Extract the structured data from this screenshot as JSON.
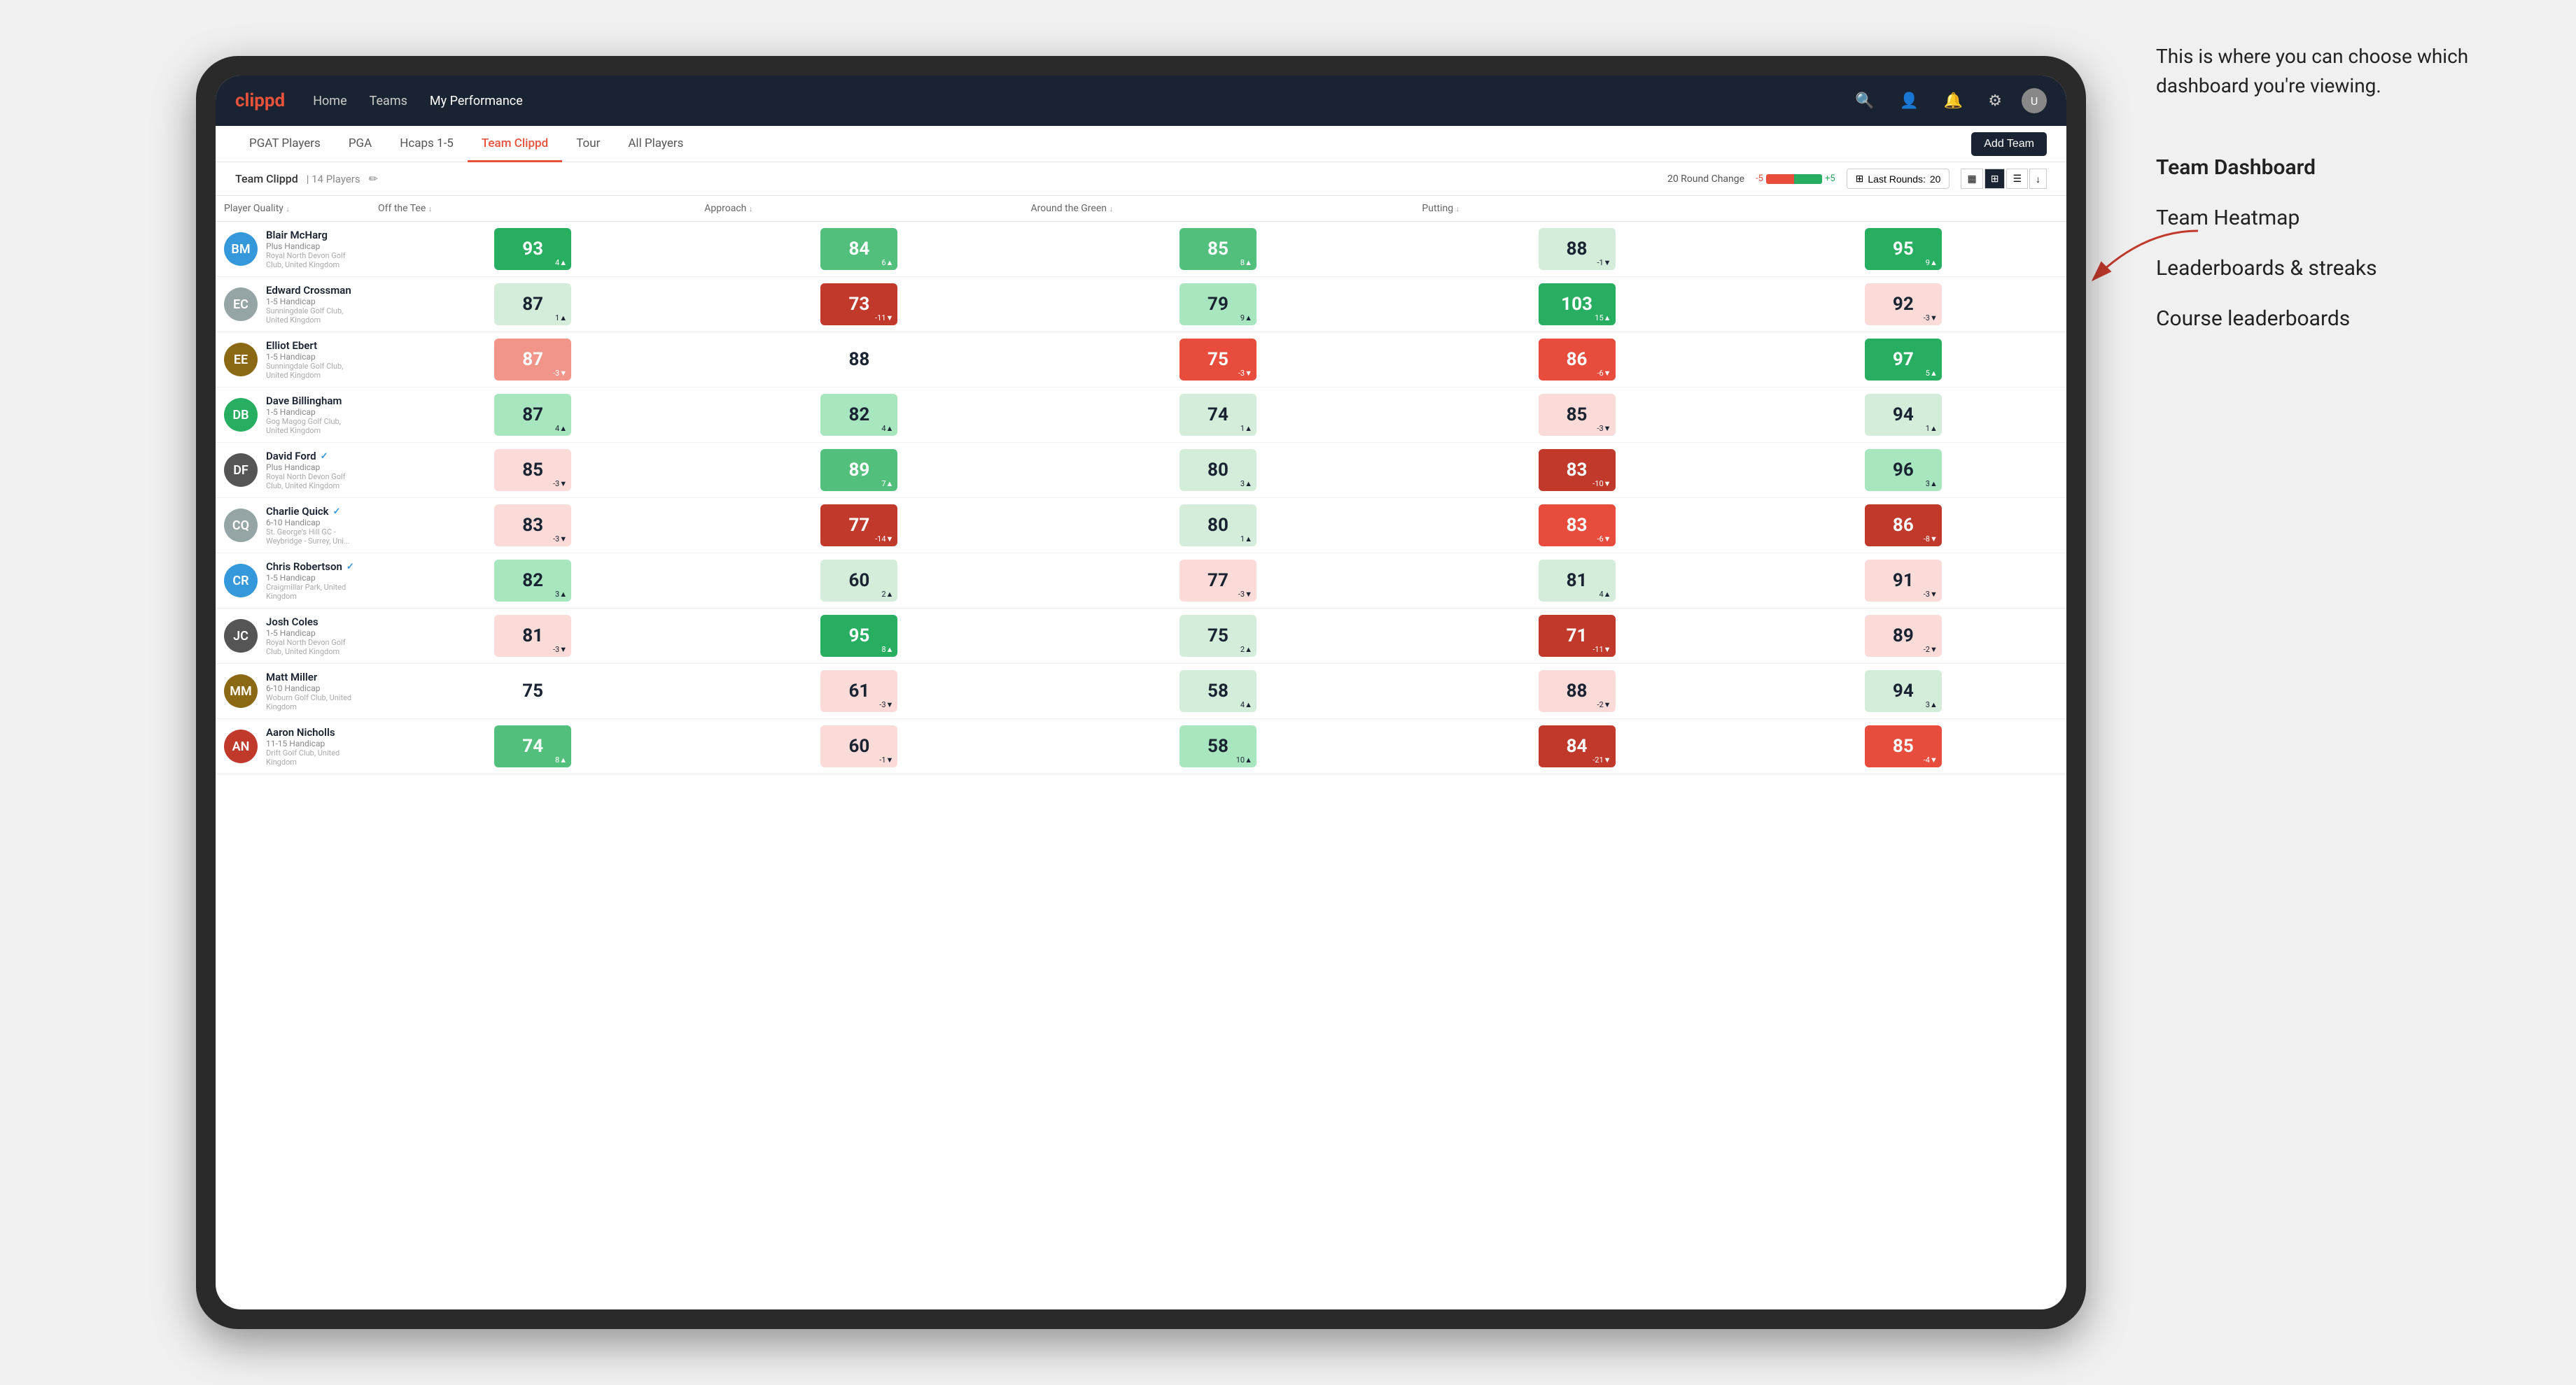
{
  "annotation": {
    "intro": "This is where you can choose which dashboard you're viewing.",
    "items": [
      {
        "label": "Team Dashboard",
        "active": true
      },
      {
        "label": "Team Heatmap",
        "active": false
      },
      {
        "label": "Leaderboards & streaks",
        "active": false
      },
      {
        "label": "Course leaderboards",
        "active": false
      }
    ]
  },
  "nav": {
    "logo": "clippd",
    "links": [
      "Home",
      "Teams",
      "My Performance"
    ],
    "icons": [
      "search",
      "user",
      "bell",
      "settings",
      "avatar"
    ]
  },
  "sub_nav": {
    "tabs": [
      "PGAT Players",
      "PGA",
      "Hcaps 1-5",
      "Team Clippd",
      "Tour",
      "All Players"
    ],
    "active_tab": "Team Clippd",
    "add_team_btn": "Add Team"
  },
  "team_bar": {
    "name": "Team Clippd",
    "separator": "|",
    "count": "14 Players",
    "edit_icon": "✏",
    "round_change_label": "20 Round Change",
    "neg_val": "-5",
    "pos_val": "+5",
    "last_rounds_label": "Last Rounds:",
    "last_rounds_value": "20",
    "view_modes": [
      "grid-small",
      "grid-large",
      "heatmap",
      "export"
    ]
  },
  "table": {
    "columns": [
      {
        "key": "player",
        "label": "Player Quality ↓"
      },
      {
        "key": "off_tee",
        "label": "Off the Tee ↓"
      },
      {
        "key": "approach",
        "label": "Approach ↓"
      },
      {
        "key": "around_green",
        "label": "Around the Green ↓"
      },
      {
        "key": "putting",
        "label": "Putting ↓"
      }
    ],
    "rows": [
      {
        "name": "Blair McHarg",
        "handicap": "Plus Handicap",
        "club": "Royal North Devon Golf Club, United Kingdom",
        "initials": "BM",
        "av_color": "av-blue",
        "player_quality": {
          "value": "93",
          "change": "4▲",
          "color": "bg-green-dark"
        },
        "off_tee": {
          "value": "84",
          "change": "6▲",
          "color": "bg-green-mid"
        },
        "approach": {
          "value": "85",
          "change": "8▲",
          "color": "bg-green-mid"
        },
        "around_green": {
          "value": "88",
          "change": "-1▼",
          "color": "bg-green-pale"
        },
        "putting": {
          "value": "95",
          "change": "9▲",
          "color": "bg-green-dark"
        }
      },
      {
        "name": "Edward Crossman",
        "handicap": "1-5 Handicap",
        "club": "Sunningdale Golf Club, United Kingdom",
        "initials": "EC",
        "av_color": "av-gray",
        "player_quality": {
          "value": "87",
          "change": "1▲",
          "color": "bg-green-pale"
        },
        "off_tee": {
          "value": "73",
          "change": "-11▼",
          "color": "bg-red-dark"
        },
        "approach": {
          "value": "79",
          "change": "9▲",
          "color": "bg-green-light"
        },
        "around_green": {
          "value": "103",
          "change": "15▲",
          "color": "bg-green-dark"
        },
        "putting": {
          "value": "92",
          "change": "-3▼",
          "color": "bg-red-pale"
        }
      },
      {
        "name": "Elliot Ebert",
        "handicap": "1-5 Handicap",
        "club": "Sunningdale Golf Club, United Kingdom",
        "initials": "EE",
        "av_color": "av-brown",
        "player_quality": {
          "value": "87",
          "change": "-3▼",
          "color": "bg-red-light"
        },
        "off_tee": {
          "value": "88",
          "change": "",
          "color": "bg-white"
        },
        "approach": {
          "value": "75",
          "change": "-3▼",
          "color": "bg-red-mid"
        },
        "around_green": {
          "value": "86",
          "change": "-6▼",
          "color": "bg-red-mid"
        },
        "putting": {
          "value": "97",
          "change": "5▲",
          "color": "bg-green-dark"
        }
      },
      {
        "name": "Dave Billingham",
        "handicap": "1-5 Handicap",
        "club": "Gog Magog Golf Club, United Kingdom",
        "initials": "DB",
        "av_color": "av-green",
        "player_quality": {
          "value": "87",
          "change": "4▲",
          "color": "bg-green-light"
        },
        "off_tee": {
          "value": "82",
          "change": "4▲",
          "color": "bg-green-light"
        },
        "approach": {
          "value": "74",
          "change": "1▲",
          "color": "bg-green-pale"
        },
        "around_green": {
          "value": "85",
          "change": "-3▼",
          "color": "bg-red-pale"
        },
        "putting": {
          "value": "94",
          "change": "1▲",
          "color": "bg-green-pale"
        }
      },
      {
        "name": "David Ford",
        "handicap": "Plus Handicap",
        "club": "Royal North Devon Golf Club, United Kingdom",
        "initials": "DF",
        "av_color": "av-dark",
        "verified": true,
        "player_quality": {
          "value": "85",
          "change": "-3▼",
          "color": "bg-red-pale"
        },
        "off_tee": {
          "value": "89",
          "change": "7▲",
          "color": "bg-green-mid"
        },
        "approach": {
          "value": "80",
          "change": "3▲",
          "color": "bg-green-pale"
        },
        "around_green": {
          "value": "83",
          "change": "-10▼",
          "color": "bg-red-dark"
        },
        "putting": {
          "value": "96",
          "change": "3▲",
          "color": "bg-green-light"
        }
      },
      {
        "name": "Charlie Quick",
        "handicap": "6-10 Handicap",
        "club": "St. George's Hill GC - Weybridge - Surrey, Uni...",
        "initials": "CQ",
        "av_color": "av-gray",
        "verified": true,
        "player_quality": {
          "value": "83",
          "change": "-3▼",
          "color": "bg-red-pale"
        },
        "off_tee": {
          "value": "77",
          "change": "-14▼",
          "color": "bg-red-dark"
        },
        "approach": {
          "value": "80",
          "change": "1▲",
          "color": "bg-green-pale"
        },
        "around_green": {
          "value": "83",
          "change": "-6▼",
          "color": "bg-red-mid"
        },
        "putting": {
          "value": "86",
          "change": "-8▼",
          "color": "bg-red-dark"
        }
      },
      {
        "name": "Chris Robertson",
        "handicap": "1-5 Handicap",
        "club": "Craigmillar Park, United Kingdom",
        "initials": "CR",
        "av_color": "av-blue",
        "verified": true,
        "player_quality": {
          "value": "82",
          "change": "3▲",
          "color": "bg-green-light"
        },
        "off_tee": {
          "value": "60",
          "change": "2▲",
          "color": "bg-green-pale"
        },
        "approach": {
          "value": "77",
          "change": "-3▼",
          "color": "bg-red-pale"
        },
        "around_green": {
          "value": "81",
          "change": "4▲",
          "color": "bg-green-pale"
        },
        "putting": {
          "value": "91",
          "change": "-3▼",
          "color": "bg-red-pale"
        }
      },
      {
        "name": "Josh Coles",
        "handicap": "1-5 Handicap",
        "club": "Royal North Devon Golf Club, United Kingdom",
        "initials": "JC",
        "av_color": "av-dark",
        "player_quality": {
          "value": "81",
          "change": "-3▼",
          "color": "bg-red-pale"
        },
        "off_tee": {
          "value": "95",
          "change": "8▲",
          "color": "bg-green-dark"
        },
        "approach": {
          "value": "75",
          "change": "2▲",
          "color": "bg-green-pale"
        },
        "around_green": {
          "value": "71",
          "change": "-11▼",
          "color": "bg-red-dark"
        },
        "putting": {
          "value": "89",
          "change": "-2▼",
          "color": "bg-red-pale"
        }
      },
      {
        "name": "Matt Miller",
        "handicap": "6-10 Handicap",
        "club": "Woburn Golf Club, United Kingdom",
        "initials": "MM",
        "av_color": "av-brown",
        "player_quality": {
          "value": "75",
          "change": "",
          "color": "bg-white"
        },
        "off_tee": {
          "value": "61",
          "change": "-3▼",
          "color": "bg-red-pale"
        },
        "approach": {
          "value": "58",
          "change": "4▲",
          "color": "bg-green-pale"
        },
        "around_green": {
          "value": "88",
          "change": "-2▼",
          "color": "bg-red-pale"
        },
        "putting": {
          "value": "94",
          "change": "3▲",
          "color": "bg-green-pale"
        }
      },
      {
        "name": "Aaron Nicholls",
        "handicap": "11-15 Handicap",
        "club": "Drift Golf Club, United Kingdom",
        "initials": "AN",
        "av_color": "av-red",
        "player_quality": {
          "value": "74",
          "change": "8▲",
          "color": "bg-green-mid"
        },
        "off_tee": {
          "value": "60",
          "change": "-1▼",
          "color": "bg-red-pale"
        },
        "approach": {
          "value": "58",
          "change": "10▲",
          "color": "bg-green-light"
        },
        "around_green": {
          "value": "84",
          "change": "-21▼",
          "color": "bg-red-dark"
        },
        "putting": {
          "value": "85",
          "change": "-4▼",
          "color": "bg-red-mid"
        }
      }
    ]
  }
}
